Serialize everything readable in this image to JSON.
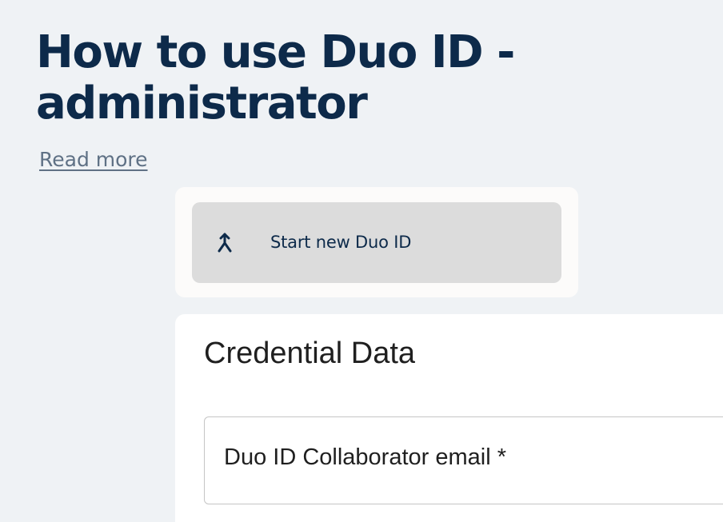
{
  "header": {
    "title": "How to use Duo ID - administrator",
    "read_more": "Read more"
  },
  "actions": {
    "start_button_label": "Start new Duo ID",
    "start_button_icon": "merge-icon"
  },
  "credential_section": {
    "title": "Credential Data",
    "email_field_label": "Duo ID Collaborator email *"
  },
  "colors": {
    "background": "#eff2f5",
    "title": "#0d2a4a",
    "link": "#5f7185",
    "button": "#dcdcdc",
    "card": "#ffffff"
  }
}
